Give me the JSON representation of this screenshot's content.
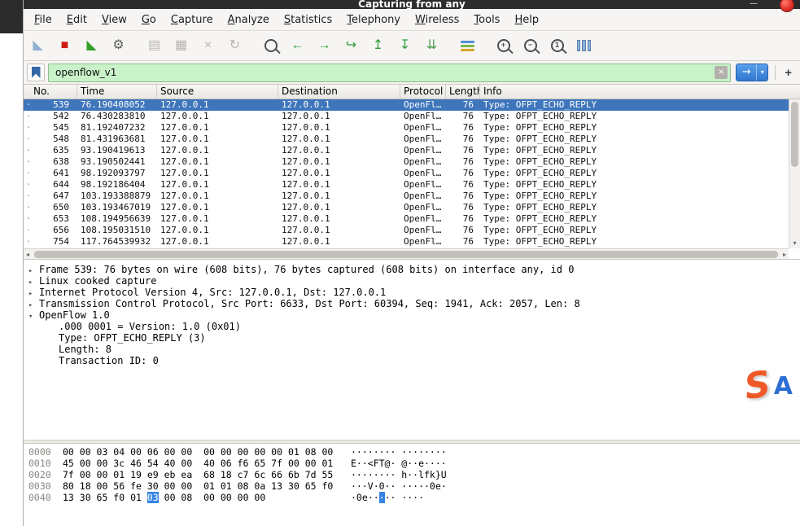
{
  "titlebar": {
    "title": "Capturing from any",
    "minimize_glyph": "—"
  },
  "glyphs": {
    "down": "▾",
    "left": "◂",
    "right": "▸"
  },
  "menu": {
    "items": [
      "File",
      "Edit",
      "View",
      "Go",
      "Capture",
      "Analyze",
      "Statistics",
      "Telephony",
      "Wireless",
      "Tools",
      "Help"
    ]
  },
  "toolbar": {
    "icons": [
      {
        "name": "start-capture-fin-icon",
        "type": "glyph",
        "glyph": "◣",
        "color": "#8fb0d0",
        "group_end": false
      },
      {
        "name": "stop-capture-icon",
        "type": "glyph",
        "glyph": "■",
        "color": "#d11a14",
        "group_end": false
      },
      {
        "name": "restart-capture-icon",
        "type": "glyph",
        "glyph": "◣",
        "color": "#33a02c",
        "group_end": false
      },
      {
        "name": "capture-options-gear-icon",
        "type": "glyph",
        "glyph": "⚙",
        "color": "#5e5c58",
        "group_end": true
      },
      {
        "name": "open-file-icon",
        "type": "glyph",
        "glyph": "▤",
        "color": "#b9b6b0",
        "group_end": false
      },
      {
        "name": "save-file-icon",
        "type": "glyph",
        "glyph": "▦",
        "color": "#b9b6b0",
        "group_end": false
      },
      {
        "name": "close-file-icon",
        "type": "glyph",
        "glyph": "×",
        "color": "#b9b6b0",
        "group_end": false
      },
      {
        "name": "reload-icon",
        "type": "glyph",
        "glyph": "↻",
        "color": "#b9b6b0",
        "group_end": true
      },
      {
        "name": "find-packet-icon",
        "type": "magnifier",
        "inner": "",
        "group_end": false
      },
      {
        "name": "go-back-icon",
        "type": "glyph",
        "glyph": "←",
        "color": "#2e9e3a",
        "group_end": false
      },
      {
        "name": "go-forward-icon",
        "type": "glyph",
        "glyph": "→",
        "color": "#2e9e3a",
        "group_end": false
      },
      {
        "name": "go-to-packet-icon",
        "type": "glyph",
        "glyph": "↪",
        "color": "#2e9e3a",
        "group_end": false
      },
      {
        "name": "go-first-packet-icon",
        "type": "glyph",
        "glyph": "↥",
        "color": "#2e9e3a",
        "group_end": false
      },
      {
        "name": "go-last-packet-icon",
        "type": "glyph",
        "glyph": "↧",
        "color": "#2e9e3a",
        "group_end": false
      },
      {
        "name": "auto-scroll-icon",
        "type": "glyph",
        "glyph": "⇊",
        "color": "#4f9e4f",
        "group_end": true
      },
      {
        "name": "colorize-icon",
        "type": "colorbars",
        "group_end": true
      },
      {
        "name": "zoom-in-icon",
        "type": "magnifier",
        "inner": "+",
        "group_end": false
      },
      {
        "name": "zoom-out-icon",
        "type": "magnifier",
        "inner": "−",
        "group_end": false
      },
      {
        "name": "zoom-100-icon",
        "type": "magnifier",
        "inner": "1",
        "group_end": false
      },
      {
        "name": "resize-columns-icon",
        "type": "columns",
        "group_end": false
      }
    ],
    "colorbar_colors": [
      "#4f8fd6",
      "#7ab648",
      "#d9a62e"
    ]
  },
  "filter": {
    "value": "openflow_v1",
    "clear_glyph": "×",
    "apply_glyph": "→",
    "dropdown_glyph": "▾",
    "add_glyph": "+"
  },
  "packet_list": {
    "marker_glyph": "·",
    "columns": [
      "No.",
      "Time",
      "Source",
      "Destination",
      "Protocol",
      "Length",
      "Info"
    ],
    "rows": [
      {
        "no": "539",
        "time": "76.190408052",
        "source": "127.0.0.1",
        "destination": "127.0.0.1",
        "protocol": "OpenFl…",
        "length": "76",
        "info": "Type: OFPT_ECHO_REPLY",
        "selected": true
      },
      {
        "no": "542",
        "time": "76.430283810",
        "source": "127.0.0.1",
        "destination": "127.0.0.1",
        "protocol": "OpenFl…",
        "length": "76",
        "info": "Type: OFPT_ECHO_REPLY",
        "selected": false
      },
      {
        "no": "545",
        "time": "81.192407232",
        "source": "127.0.0.1",
        "destination": "127.0.0.1",
        "protocol": "OpenFl…",
        "length": "76",
        "info": "Type: OFPT_ECHO_REPLY",
        "selected": false
      },
      {
        "no": "548",
        "time": "81.431963681",
        "source": "127.0.0.1",
        "destination": "127.0.0.1",
        "protocol": "OpenFl…",
        "length": "76",
        "info": "Type: OFPT_ECHO_REPLY",
        "selected": false
      },
      {
        "no": "635",
        "time": "93.190419613",
        "source": "127.0.0.1",
        "destination": "127.0.0.1",
        "protocol": "OpenFl…",
        "length": "76",
        "info": "Type: OFPT_ECHO_REPLY",
        "selected": false
      },
      {
        "no": "638",
        "time": "93.190502441",
        "source": "127.0.0.1",
        "destination": "127.0.0.1",
        "protocol": "OpenFl…",
        "length": "76",
        "info": "Type: OFPT_ECHO_REPLY",
        "selected": false
      },
      {
        "no": "641",
        "time": "98.192093797",
        "source": "127.0.0.1",
        "destination": "127.0.0.1",
        "protocol": "OpenFl…",
        "length": "76",
        "info": "Type: OFPT_ECHO_REPLY",
        "selected": false
      },
      {
        "no": "644",
        "time": "98.192186404",
        "source": "127.0.0.1",
        "destination": "127.0.0.1",
        "protocol": "OpenFl…",
        "length": "76",
        "info": "Type: OFPT_ECHO_REPLY",
        "selected": false
      },
      {
        "no": "647",
        "time": "103.193388879",
        "source": "127.0.0.1",
        "destination": "127.0.0.1",
        "protocol": "OpenFl…",
        "length": "76",
        "info": "Type: OFPT_ECHO_REPLY",
        "selected": false
      },
      {
        "no": "650",
        "time": "103.193467019",
        "source": "127.0.0.1",
        "destination": "127.0.0.1",
        "protocol": "OpenFl…",
        "length": "76",
        "info": "Type: OFPT_ECHO_REPLY",
        "selected": false
      },
      {
        "no": "653",
        "time": "108.194956639",
        "source": "127.0.0.1",
        "destination": "127.0.0.1",
        "protocol": "OpenFl…",
        "length": "76",
        "info": "Type: OFPT_ECHO_REPLY",
        "selected": false
      },
      {
        "no": "656",
        "time": "108.195031510",
        "source": "127.0.0.1",
        "destination": "127.0.0.1",
        "protocol": "OpenFl…",
        "length": "76",
        "info": "Type: OFPT_ECHO_REPLY",
        "selected": false
      },
      {
        "no": "754",
        "time": "117.764539932",
        "source": "127.0.0.1",
        "destination": "127.0.0.1",
        "protocol": "OpenFl…",
        "length": "76",
        "info": "Type: OFPT_ECHO_REPLY",
        "selected": false
      }
    ]
  },
  "details": {
    "arrow_glyphs": {
      "collapsed": "▸",
      "expanded": "▾",
      "none": ""
    },
    "lines": [
      {
        "arrow": "collapsed",
        "indent": 0,
        "text": "Frame 539: 76 bytes on wire (608 bits), 76 bytes captured (608 bits) on interface any, id 0"
      },
      {
        "arrow": "collapsed",
        "indent": 0,
        "text": "Linux cooked capture"
      },
      {
        "arrow": "collapsed",
        "indent": 0,
        "text": "Internet Protocol Version 4, Src: 127.0.0.1, Dst: 127.0.0.1"
      },
      {
        "arrow": "collapsed",
        "indent": 0,
        "text": "Transmission Control Protocol, Src Port: 6633, Dst Port: 60394, Seq: 1941, Ack: 2057, Len: 8"
      },
      {
        "arrow": "expanded",
        "indent": 0,
        "text": "OpenFlow 1.0"
      },
      {
        "arrow": "none",
        "indent": 1,
        "text": ".000 0001 = Version: 1.0 (0x01)"
      },
      {
        "arrow": "none",
        "indent": 1,
        "text": "Type: OFPT_ECHO_REPLY (3)"
      },
      {
        "arrow": "none",
        "indent": 1,
        "text": "Length: 8"
      },
      {
        "arrow": "none",
        "indent": 1,
        "text": "Transaction ID: 0"
      }
    ]
  },
  "hex": {
    "rows": [
      {
        "offset": "0000",
        "hex_pre": "00 00 03 04 00 06 00 00  00 00 00 00 00 01 08 00",
        "hex_hl": "",
        "hex_post": "",
        "ascii_pre": "········ ········",
        "ascii_hl": "",
        "ascii_post": ""
      },
      {
        "offset": "0010",
        "hex_pre": "45 00 00 3c 46 54 40 00  40 06 f6 65 7f 00 00 01",
        "hex_hl": "",
        "hex_post": "",
        "ascii_pre": "E··<FT@· @··e····",
        "ascii_hl": "",
        "ascii_post": ""
      },
      {
        "offset": "0020",
        "hex_pre": "7f 00 00 01 19 e9 eb ea  68 18 c7 6c 66 6b 7d 55",
        "hex_hl": "",
        "hex_post": "",
        "ascii_pre": "········ h··lfk}U",
        "ascii_hl": "",
        "ascii_post": ""
      },
      {
        "offset": "0030",
        "hex_pre": "80 18 00 56 fe 30 00 00  01 01 08 0a 13 30 65 f0",
        "hex_hl": "",
        "hex_post": "",
        "ascii_pre": "···V·0·· ·····0e·",
        "ascii_hl": "",
        "ascii_post": ""
      },
      {
        "offset": "0040",
        "hex_pre": "13 30 65 f0 01 ",
        "hex_hl": "03",
        "hex_post": " 00 08  00 00 00 00",
        "ascii_pre": "·0e··",
        "ascii_hl": "·",
        "ascii_post": "·· ····"
      }
    ]
  },
  "watermark": {
    "s_letter": "S",
    "a_letter": "A",
    "s_color": "#f05a28",
    "a_color": "#2d6fd2"
  },
  "colors": {
    "titlebar_bg": "#2c2c2c",
    "selection_blue": "#3f76bb",
    "filter_valid_bg": "#c9f2c9",
    "hex_highlight_bg": "#3584e4",
    "record_indicator": "#e0322a"
  }
}
